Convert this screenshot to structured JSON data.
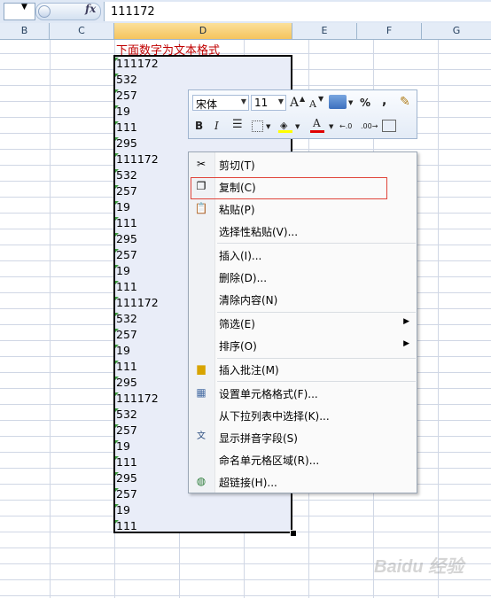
{
  "formula_bar": {
    "fx_label": "fx",
    "value": "111172"
  },
  "columns": [
    "B",
    "C",
    "D",
    "E",
    "F",
    "G"
  ],
  "selected_column": "D",
  "sheet": {
    "d1_note": "下面数字为文本格式",
    "cells": [
      "111172",
      "532",
      "257",
      "19",
      "111",
      "295",
      "111172",
      "532",
      "257",
      "19",
      "111",
      "295",
      "257",
      "19",
      "111",
      "111172",
      "532",
      "257",
      "19",
      "111",
      "295",
      "111172",
      "532",
      "257",
      "19",
      "111",
      "295",
      "257",
      "19",
      "111"
    ]
  },
  "mini_toolbar": {
    "font_name": "宋体",
    "font_size": "11",
    "grow_font": "A",
    "shrink_font": "A",
    "percent": "%",
    "comma": ",",
    "bold": "B",
    "italic": "I",
    "font_color": "A",
    "inc_decimal": "←.0",
    "dec_decimal": ".00→"
  },
  "context_menu": {
    "items": [
      {
        "label": "剪切(T)",
        "icon": "scissors-icon"
      },
      {
        "label": "复制(C)",
        "icon": "copy-icon"
      },
      {
        "label": "粘贴(P)",
        "icon": "paste-icon"
      },
      {
        "label": "选择性粘贴(V)..."
      },
      {
        "label": "插入(I)..."
      },
      {
        "label": "删除(D)..."
      },
      {
        "label": "清除内容(N)"
      },
      {
        "label": "筛选(E)",
        "submenu": true
      },
      {
        "label": "排序(O)",
        "submenu": true
      },
      {
        "label": "插入批注(M)",
        "icon": "comment-icon"
      },
      {
        "label": "设置单元格格式(F)...",
        "icon": "format-cells-icon"
      },
      {
        "label": "从下拉列表中选择(K)..."
      },
      {
        "label": "显示拼音字段(S)",
        "icon": "phonetic-icon"
      },
      {
        "label": "命名单元格区域(R)..."
      },
      {
        "label": "超链接(H)...",
        "icon": "hyperlink-icon"
      }
    ]
  },
  "watermark": "Baidu 经验",
  "colors": {
    "selection_border": "#000000",
    "header_selected": "#f5c45d",
    "note_text": "#c00000",
    "highlight_box": "#e0443a"
  }
}
